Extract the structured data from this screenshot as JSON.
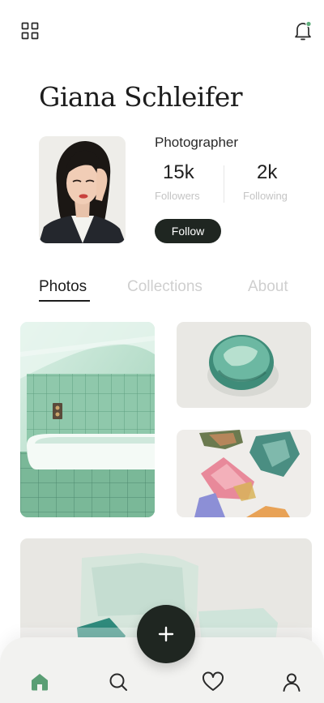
{
  "header": {
    "menu_icon": "grid-icon",
    "notification_icon": "bell-icon",
    "notification_dot_color": "#5fae7c"
  },
  "profile": {
    "name": "Giana Schleifer",
    "role": "Photographer",
    "followers_value": "15k",
    "followers_label": "Followers",
    "following_value": "2k",
    "following_label": "Following",
    "follow_label": "Follow"
  },
  "tabs": [
    {
      "label": "Photos",
      "active": true
    },
    {
      "label": "Collections",
      "active": false
    },
    {
      "label": "About",
      "active": false
    }
  ],
  "photos": [
    {
      "subject": "green tiled bathtub"
    },
    {
      "subject": "green glass stone"
    },
    {
      "subject": "colorful crystals"
    },
    {
      "subject": "sea glass pieces"
    }
  ],
  "nav": {
    "items": [
      {
        "icon": "home-icon",
        "active": true
      },
      {
        "icon": "search-icon",
        "active": false
      },
      {
        "icon": "heart-icon",
        "active": false
      },
      {
        "icon": "user-icon",
        "active": false
      }
    ],
    "fab_icon": "plus-icon"
  },
  "colors": {
    "accent": "#5a9e74",
    "dark": "#1f2621",
    "muted": "#c4c4c4"
  }
}
